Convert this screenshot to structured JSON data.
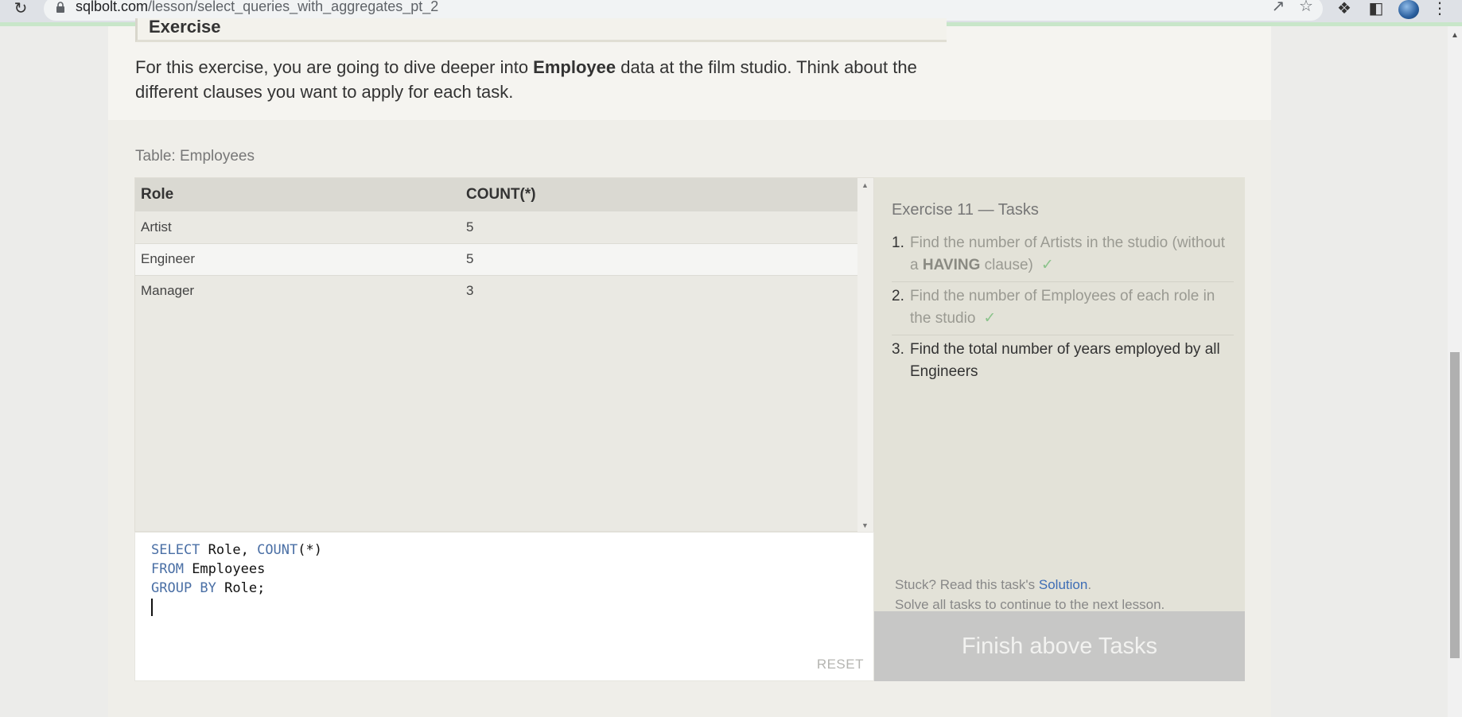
{
  "browser": {
    "url_host": "sqlbolt.com",
    "url_path": "/lesson/select_queries_with_aggregates_pt_2"
  },
  "intro": {
    "heading": "Exercise",
    "text_before": "For this exercise, you are going to dive deeper into ",
    "text_bold": "Employee",
    "text_after": " data at the film studio. Think about the different clauses you want to apply for each task."
  },
  "results": {
    "table_label": "Table: Employees",
    "columns": [
      "Role",
      "COUNT(*)"
    ],
    "rows": [
      [
        "Artist",
        "5"
      ],
      [
        "Engineer",
        "5"
      ],
      [
        "Manager",
        "3"
      ]
    ]
  },
  "editor": {
    "line1_kw1": "SELECT",
    "line1_rest1": " Role, ",
    "line1_kw2": "COUNT",
    "line1_rest2": "(*)",
    "line2_kw": "FROM",
    "line2_rest": " Employees",
    "line3_kw": "GROUP BY",
    "line3_rest": " Role;",
    "reset_label": "RESET"
  },
  "tasks": {
    "title": "Exercise 11 — Tasks",
    "items": [
      {
        "num": "1.",
        "text_before": "Find the number of Artists in the studio (without a ",
        "bold": "HAVING",
        "text_after": " clause)",
        "check": "✓"
      },
      {
        "num": "2.",
        "text": "Find the number of Employees of each role in the studio",
        "check": "✓"
      },
      {
        "num": "3.",
        "text": "Find the total number of years employed by all Engineers"
      }
    ],
    "hint_before": "Stuck? Read this task's ",
    "hint_link": "Solution",
    "hint_after": ".",
    "hint_line2": "Solve all tasks to continue to the next lesson.",
    "finish_label": "Finish above Tasks"
  },
  "colors": {
    "keyword": "#4a6fa5",
    "check": "#8cc38c",
    "link": "#3d6db5"
  }
}
